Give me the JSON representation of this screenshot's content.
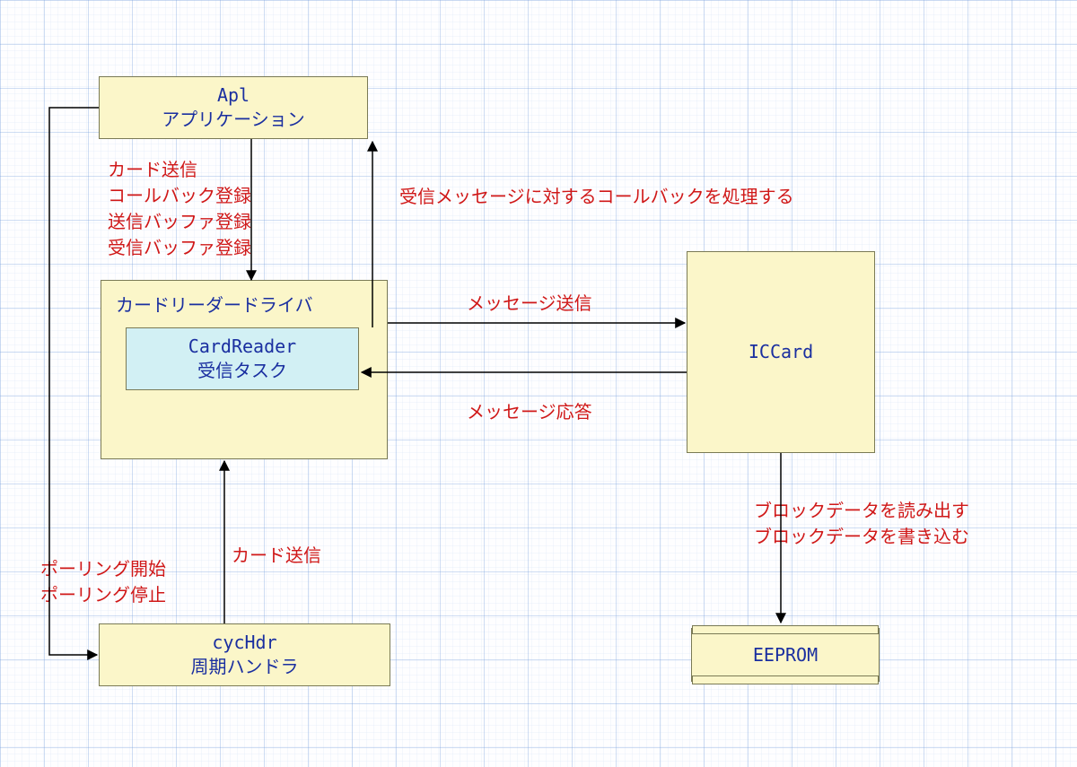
{
  "boxes": {
    "apl": {
      "line1": "Apl",
      "line2": "アプリケーション"
    },
    "driver": {
      "title": "カードリーダードライバ"
    },
    "task": {
      "line1": "CardReader",
      "line2": "受信タスク"
    },
    "iccard": {
      "line1": "ICCard"
    },
    "cyc": {
      "line1": "cycHdr",
      "line2": "周期ハンドラ"
    },
    "eeprom": {
      "line1": "EEPROM"
    }
  },
  "labels": {
    "apl_to_driver": "カード送信\nコールバック登録\n送信バッファ登録\n受信バッファ登録",
    "callback": "受信メッセージに対するコールバックを処理する",
    "msg_send": "メッセージ送信",
    "msg_resp": "メッセージ応答",
    "polling": "ポーリング開始\nポーリング停止",
    "card_send": "カード送信",
    "block_rw": "ブロックデータを読み出す\nブロックデータを書き込む"
  },
  "colors": {
    "box_fill": "#fbf6c9",
    "box_alt": "#d2f0f4",
    "text_blue": "#1a2fa0",
    "text_red": "#d01818"
  }
}
